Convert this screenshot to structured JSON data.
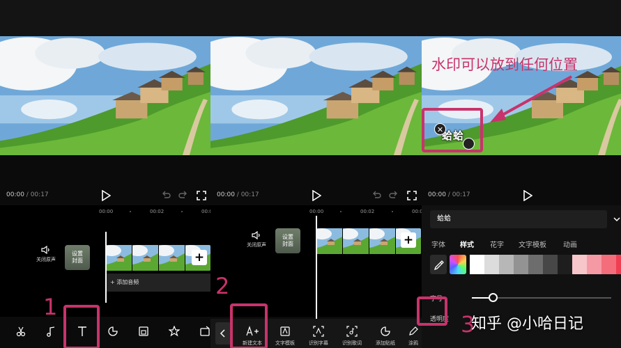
{
  "time": {
    "current": "00:00",
    "separator": " / ",
    "total": "00:17"
  },
  "ruler": {
    "t0": "00:00",
    "t1": "00:02",
    "t2": "00:0"
  },
  "timeline": {
    "mute_label": "关闭原声",
    "cover_label_line1": "设置",
    "cover_label_line2": "封面",
    "add_audio": "+ 添加音频"
  },
  "toolbar_panel2": {
    "new_text": "新建文本",
    "text_template": "文字模板",
    "auto_captions": "识别字幕",
    "lyrics": "识别歌词",
    "add_sticker": "添加贴纸",
    "draw": "涂鸦"
  },
  "steps": {
    "one": "1",
    "two": "2",
    "three": "3"
  },
  "panel3": {
    "text_value": "蛤蛤",
    "tabs": [
      "字体",
      "样式",
      "花字",
      "文字模板",
      "动画"
    ],
    "active_tab": "样式",
    "slider_label": "字号",
    "opacity_label": "透明度"
  },
  "watermark": {
    "annotation": "水印可以放到任何位置",
    "overlay_text": "蛤蛤",
    "brand": "知乎 @小哈日记"
  },
  "colors": {
    "accent": "#c8336b",
    "swatches": [
      "#ffffff",
      "#dcdcdc",
      "#b7b7b7",
      "#939393",
      "#6d6d6d",
      "#474747",
      "#1e1e1e",
      "#f7c6cb",
      "#f59aa4",
      "#f36d7b",
      "#ef3e52",
      "#e3122a",
      "#b70f22"
    ]
  },
  "icons": [
    "scissors-icon",
    "music-note-icon",
    "text-icon",
    "sticker-icon",
    "picture-in-picture-icon",
    "effects-icon",
    "filter-icon",
    "play-icon",
    "undo-icon",
    "redo-icon",
    "fullscreen-icon",
    "volume-icon",
    "add-icon",
    "eyedropper-icon",
    "chevron-down-icon",
    "back-icon"
  ]
}
